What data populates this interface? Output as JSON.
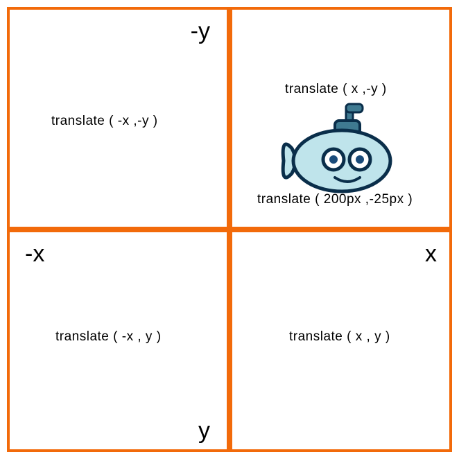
{
  "axis": {
    "neg_y": "-y",
    "neg_x": "-x",
    "pos_x": "x",
    "pos_y": "y"
  },
  "quadrants": {
    "top_left": {
      "formula": "translate ( -x ,-y )"
    },
    "top_right": {
      "formula": "translate ( x ,-y )",
      "example": "translate ( 200px ,-25px )",
      "icon": "submarine"
    },
    "bottom_left": {
      "formula": "translate ( -x , y )"
    },
    "bottom_right": {
      "formula": "translate ( x , y )"
    }
  },
  "colors": {
    "border": "#f26a0a",
    "submarine_body": "#bfe4eb",
    "submarine_outline": "#0a2e4a",
    "submarine_periscope": "#3f7a91",
    "submarine_eye": "#1a4b7a"
  }
}
